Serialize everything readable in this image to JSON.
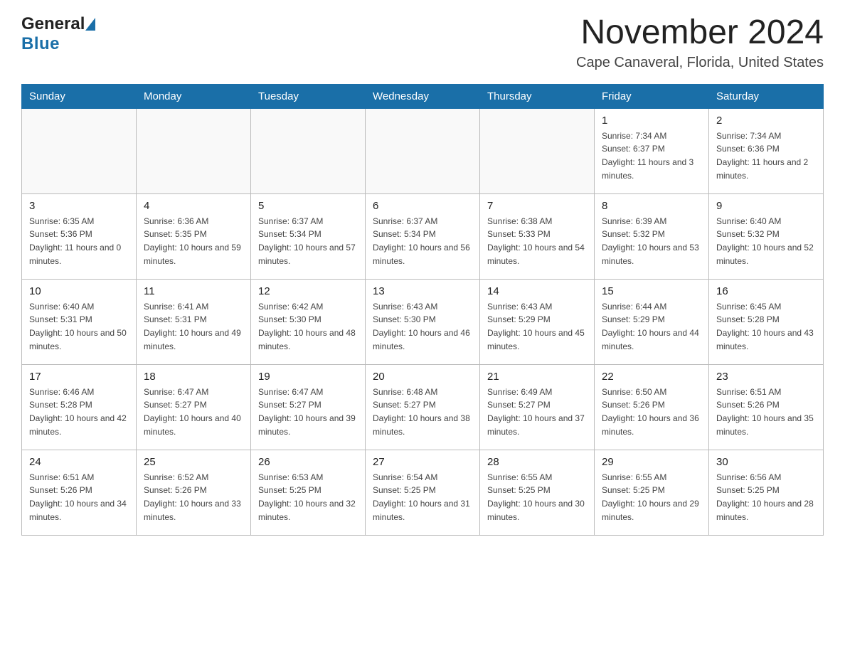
{
  "logo": {
    "general_text": "General",
    "blue_text": "Blue"
  },
  "title": "November 2024",
  "location": "Cape Canaveral, Florida, United States",
  "days_of_week": [
    "Sunday",
    "Monday",
    "Tuesday",
    "Wednesday",
    "Thursday",
    "Friday",
    "Saturday"
  ],
  "weeks": [
    [
      {
        "day": "",
        "sunrise": "",
        "sunset": "",
        "daylight": ""
      },
      {
        "day": "",
        "sunrise": "",
        "sunset": "",
        "daylight": ""
      },
      {
        "day": "",
        "sunrise": "",
        "sunset": "",
        "daylight": ""
      },
      {
        "day": "",
        "sunrise": "",
        "sunset": "",
        "daylight": ""
      },
      {
        "day": "",
        "sunrise": "",
        "sunset": "",
        "daylight": ""
      },
      {
        "day": "1",
        "sunrise": "Sunrise: 7:34 AM",
        "sunset": "Sunset: 6:37 PM",
        "daylight": "Daylight: 11 hours and 3 minutes."
      },
      {
        "day": "2",
        "sunrise": "Sunrise: 7:34 AM",
        "sunset": "Sunset: 6:36 PM",
        "daylight": "Daylight: 11 hours and 2 minutes."
      }
    ],
    [
      {
        "day": "3",
        "sunrise": "Sunrise: 6:35 AM",
        "sunset": "Sunset: 5:36 PM",
        "daylight": "Daylight: 11 hours and 0 minutes."
      },
      {
        "day": "4",
        "sunrise": "Sunrise: 6:36 AM",
        "sunset": "Sunset: 5:35 PM",
        "daylight": "Daylight: 10 hours and 59 minutes."
      },
      {
        "day": "5",
        "sunrise": "Sunrise: 6:37 AM",
        "sunset": "Sunset: 5:34 PM",
        "daylight": "Daylight: 10 hours and 57 minutes."
      },
      {
        "day": "6",
        "sunrise": "Sunrise: 6:37 AM",
        "sunset": "Sunset: 5:34 PM",
        "daylight": "Daylight: 10 hours and 56 minutes."
      },
      {
        "day": "7",
        "sunrise": "Sunrise: 6:38 AM",
        "sunset": "Sunset: 5:33 PM",
        "daylight": "Daylight: 10 hours and 54 minutes."
      },
      {
        "day": "8",
        "sunrise": "Sunrise: 6:39 AM",
        "sunset": "Sunset: 5:32 PM",
        "daylight": "Daylight: 10 hours and 53 minutes."
      },
      {
        "day": "9",
        "sunrise": "Sunrise: 6:40 AM",
        "sunset": "Sunset: 5:32 PM",
        "daylight": "Daylight: 10 hours and 52 minutes."
      }
    ],
    [
      {
        "day": "10",
        "sunrise": "Sunrise: 6:40 AM",
        "sunset": "Sunset: 5:31 PM",
        "daylight": "Daylight: 10 hours and 50 minutes."
      },
      {
        "day": "11",
        "sunrise": "Sunrise: 6:41 AM",
        "sunset": "Sunset: 5:31 PM",
        "daylight": "Daylight: 10 hours and 49 minutes."
      },
      {
        "day": "12",
        "sunrise": "Sunrise: 6:42 AM",
        "sunset": "Sunset: 5:30 PM",
        "daylight": "Daylight: 10 hours and 48 minutes."
      },
      {
        "day": "13",
        "sunrise": "Sunrise: 6:43 AM",
        "sunset": "Sunset: 5:30 PM",
        "daylight": "Daylight: 10 hours and 46 minutes."
      },
      {
        "day": "14",
        "sunrise": "Sunrise: 6:43 AM",
        "sunset": "Sunset: 5:29 PM",
        "daylight": "Daylight: 10 hours and 45 minutes."
      },
      {
        "day": "15",
        "sunrise": "Sunrise: 6:44 AM",
        "sunset": "Sunset: 5:29 PM",
        "daylight": "Daylight: 10 hours and 44 minutes."
      },
      {
        "day": "16",
        "sunrise": "Sunrise: 6:45 AM",
        "sunset": "Sunset: 5:28 PM",
        "daylight": "Daylight: 10 hours and 43 minutes."
      }
    ],
    [
      {
        "day": "17",
        "sunrise": "Sunrise: 6:46 AM",
        "sunset": "Sunset: 5:28 PM",
        "daylight": "Daylight: 10 hours and 42 minutes."
      },
      {
        "day": "18",
        "sunrise": "Sunrise: 6:47 AM",
        "sunset": "Sunset: 5:27 PM",
        "daylight": "Daylight: 10 hours and 40 minutes."
      },
      {
        "day": "19",
        "sunrise": "Sunrise: 6:47 AM",
        "sunset": "Sunset: 5:27 PM",
        "daylight": "Daylight: 10 hours and 39 minutes."
      },
      {
        "day": "20",
        "sunrise": "Sunrise: 6:48 AM",
        "sunset": "Sunset: 5:27 PM",
        "daylight": "Daylight: 10 hours and 38 minutes."
      },
      {
        "day": "21",
        "sunrise": "Sunrise: 6:49 AM",
        "sunset": "Sunset: 5:27 PM",
        "daylight": "Daylight: 10 hours and 37 minutes."
      },
      {
        "day": "22",
        "sunrise": "Sunrise: 6:50 AM",
        "sunset": "Sunset: 5:26 PM",
        "daylight": "Daylight: 10 hours and 36 minutes."
      },
      {
        "day": "23",
        "sunrise": "Sunrise: 6:51 AM",
        "sunset": "Sunset: 5:26 PM",
        "daylight": "Daylight: 10 hours and 35 minutes."
      }
    ],
    [
      {
        "day": "24",
        "sunrise": "Sunrise: 6:51 AM",
        "sunset": "Sunset: 5:26 PM",
        "daylight": "Daylight: 10 hours and 34 minutes."
      },
      {
        "day": "25",
        "sunrise": "Sunrise: 6:52 AM",
        "sunset": "Sunset: 5:26 PM",
        "daylight": "Daylight: 10 hours and 33 minutes."
      },
      {
        "day": "26",
        "sunrise": "Sunrise: 6:53 AM",
        "sunset": "Sunset: 5:25 PM",
        "daylight": "Daylight: 10 hours and 32 minutes."
      },
      {
        "day": "27",
        "sunrise": "Sunrise: 6:54 AM",
        "sunset": "Sunset: 5:25 PM",
        "daylight": "Daylight: 10 hours and 31 minutes."
      },
      {
        "day": "28",
        "sunrise": "Sunrise: 6:55 AM",
        "sunset": "Sunset: 5:25 PM",
        "daylight": "Daylight: 10 hours and 30 minutes."
      },
      {
        "day": "29",
        "sunrise": "Sunrise: 6:55 AM",
        "sunset": "Sunset: 5:25 PM",
        "daylight": "Daylight: 10 hours and 29 minutes."
      },
      {
        "day": "30",
        "sunrise": "Sunrise: 6:56 AM",
        "sunset": "Sunset: 5:25 PM",
        "daylight": "Daylight: 10 hours and 28 minutes."
      }
    ]
  ]
}
